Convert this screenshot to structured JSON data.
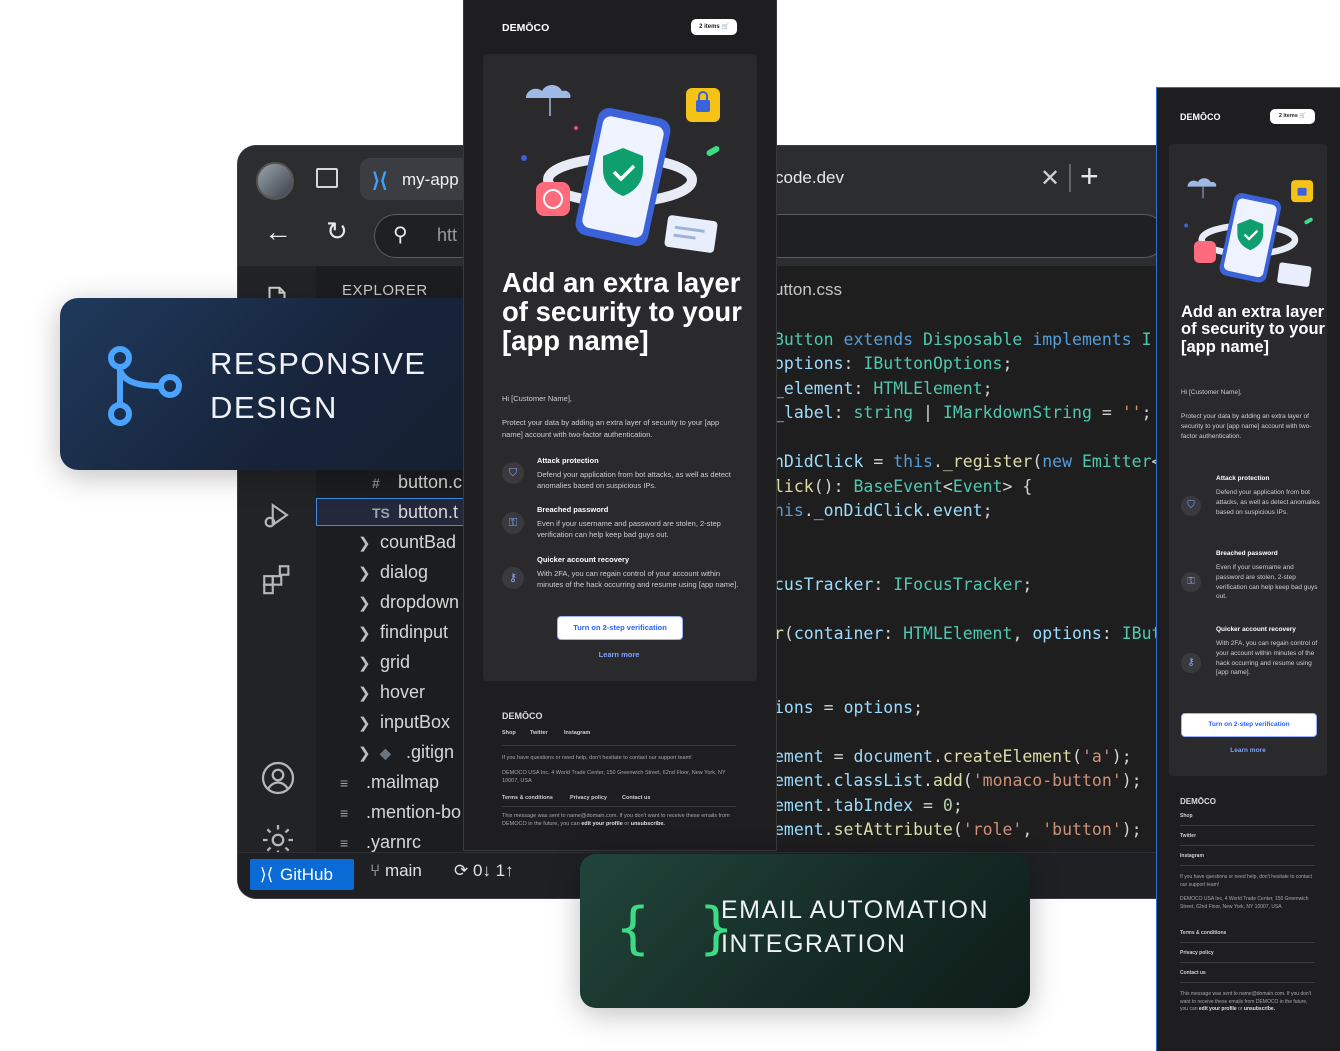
{
  "ide": {
    "tabs": {
      "active_label": "my-app",
      "url_tab": "code.dev"
    },
    "address": {
      "text": "htt"
    },
    "explorer": {
      "title": "EXPLORER",
      "items": [
        {
          "type": "file",
          "icon": "#",
          "label": "button.c"
        },
        {
          "type": "file",
          "icon": "TS",
          "label": "button.t"
        },
        {
          "type": "folder",
          "label": "countBad"
        },
        {
          "type": "folder",
          "label": "dialog"
        },
        {
          "type": "folder",
          "label": "dropdown"
        },
        {
          "type": "folder",
          "label": "findinput"
        },
        {
          "type": "folder",
          "label": "grid"
        },
        {
          "type": "folder",
          "label": "hover"
        },
        {
          "type": "folder",
          "label": "inputBox"
        },
        {
          "type": "folder",
          "label": ".gitign"
        },
        {
          "type": "file",
          "label": ".mailmap"
        },
        {
          "type": "file",
          "label": ".mention-bo"
        },
        {
          "type": "file",
          "label": ".yarnrc"
        }
      ]
    },
    "editor_tab": "utton.css",
    "status": {
      "github": "GitHub",
      "branch": "main",
      "sync": "0↓ 1↑"
    }
  },
  "cards": {
    "responsive": {
      "line1": "RESPONSIVE",
      "line2": "DESIGN"
    },
    "automation": {
      "icon_text": "{ }",
      "line1": "EMAIL AUTOMATION",
      "line2": "INTEGRATION"
    }
  },
  "email": {
    "brand": "DEMŌCO",
    "cart": "2 items",
    "headline": "Add an extra layer of security to your [app name]",
    "greeting": "Hi [Customer Name],",
    "intro": "Protect your data by adding an extra layer of security to your [app name] account with two-factor authentication.",
    "features": [
      {
        "title": "Attack protection",
        "desc": "Defend your application from bot attacks, as well as detect anomalies based on suspicious IPs."
      },
      {
        "title": "Breached password",
        "desc": "Even if your username and password are stolen, 2-step verification can help keep bad guys out."
      },
      {
        "title": "Quicker account recovery",
        "desc": "With 2FA, you can regain control of your account within minutes of the hack occurring and resume using [app name]."
      }
    ],
    "cta": "Turn on 2-step verification",
    "learn": "Learn more",
    "footer": {
      "brand": "DEMŌCO",
      "links": [
        "Shop",
        "Twitter",
        "Instagram"
      ],
      "help": "If you have questions or need help, don't hesitate to contact our support team!",
      "address": "DEMOCO USA Inc, 4 World Trade Center, 150 Greenwich Street, 62nd Floor, New York, NY 10007, USA",
      "legal": [
        "Terms & conditions",
        "Privacy policy",
        "Contact us"
      ],
      "notice_pre": "This message was sent to name@domain.com. If you don't want to receive these emails from DEMOCO in the future, you can",
      "notice_link1": "edit your profile",
      "notice_mid": "or",
      "notice_link2": "unsubscribe."
    }
  }
}
